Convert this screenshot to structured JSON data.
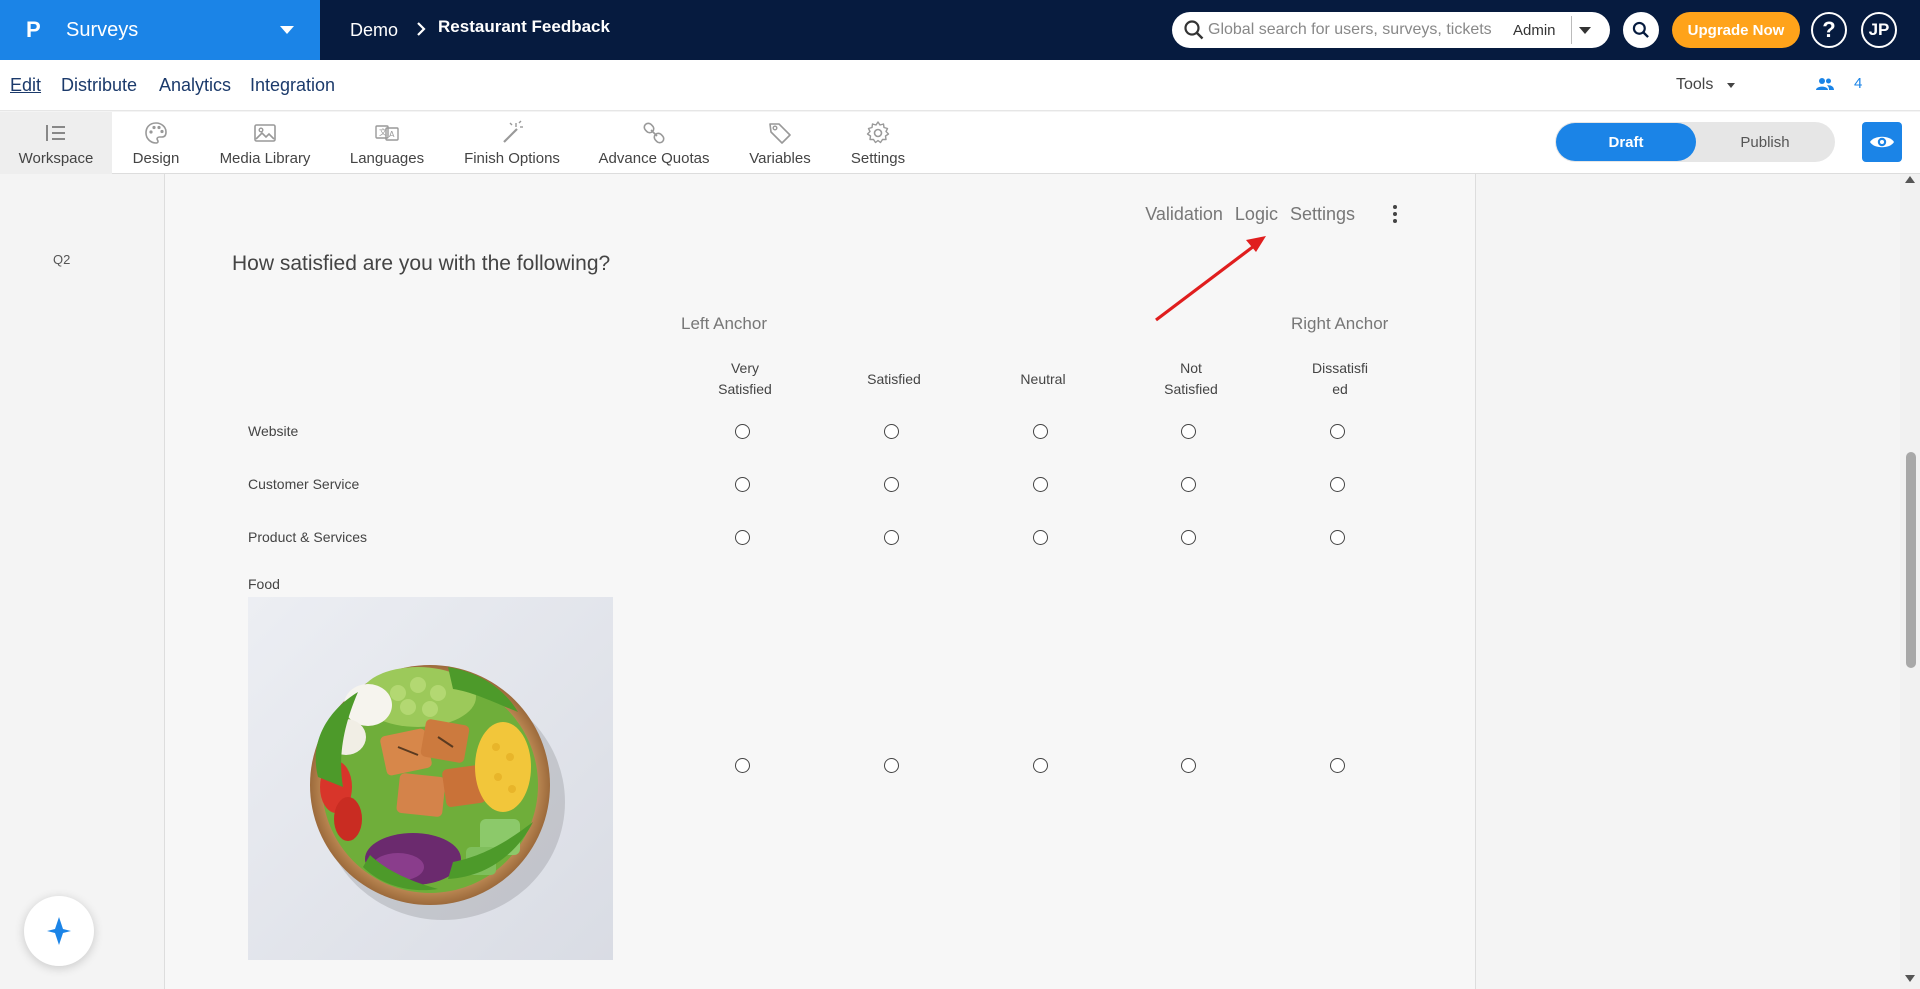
{
  "app": {
    "name": "Surveys",
    "logo_letter": "P",
    "brand_color": "#1b84e7",
    "topbar_color": "#061b3f"
  },
  "breadcrumb": {
    "project": "Demo",
    "survey": "Restaurant Feedback"
  },
  "search": {
    "placeholder": "Global search for users, surveys, tickets",
    "scope": "Admin"
  },
  "header": {
    "upgrade_label": "Upgrade Now",
    "upgrade_color": "#ffa31a",
    "help_label": "?",
    "avatar_initials": "JP"
  },
  "nav": {
    "edit": "Edit",
    "distribute": "Distribute",
    "analytics": "Analytics",
    "integration": "Integration",
    "tools": "Tools",
    "collaborators_count": "4"
  },
  "toolbar": {
    "workspace": "Workspace",
    "design": "Design",
    "media_library": "Media Library",
    "languages": "Languages",
    "finish_options": "Finish Options",
    "advance_quotas": "Advance Quotas",
    "variables": "Variables",
    "settings": "Settings",
    "draft": "Draft",
    "publish": "Publish"
  },
  "question": {
    "number": "Q2",
    "title": "How satisfied are you with the following?",
    "tools": {
      "validation": "Validation",
      "logic": "Logic",
      "settings": "Settings"
    },
    "left_anchor": "Left Anchor",
    "right_anchor": "Right Anchor",
    "columns": [
      {
        "line1": "Very",
        "line2": "Satisfied"
      },
      {
        "line1": "Satisfied",
        "line2": ""
      },
      {
        "line1": "Neutral",
        "line2": ""
      },
      {
        "line1": "Not",
        "line2": "Satisfied"
      },
      {
        "line1": "Dissatisfi",
        "line2": "ed"
      }
    ],
    "rows": [
      {
        "label": "Website"
      },
      {
        "label": "Customer Service"
      },
      {
        "label": "Product & Services"
      },
      {
        "label": "Food"
      }
    ]
  },
  "icons": {
    "search": "search-icon",
    "preview": "eye-icon",
    "assistant": "sparkle-icon",
    "collaborators": "users-icon"
  }
}
